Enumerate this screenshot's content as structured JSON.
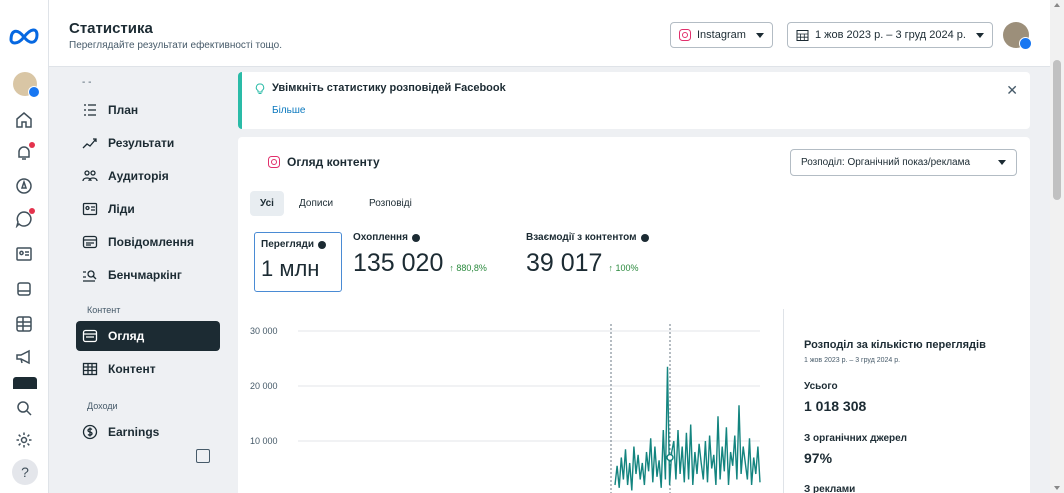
{
  "header": {
    "title": "Статистика",
    "subtitle": "Переглядайте результати ефективності тощо.",
    "platform_label": "Instagram",
    "date_range": "1 жов 2023 р. – 3 груд 2024 р."
  },
  "sidebar": {
    "top_partial": "- -",
    "items": [
      {
        "label": "План",
        "icon": "plan-icon"
      },
      {
        "label": "Результати",
        "icon": "results-icon"
      },
      {
        "label": "Аудиторія",
        "icon": "audience-icon"
      },
      {
        "label": "Ліди",
        "icon": "leads-icon"
      },
      {
        "label": "Повідомлення",
        "icon": "messages-icon"
      },
      {
        "label": "Бенчмаркінг",
        "icon": "benchmarking-icon"
      }
    ],
    "section_content": "Контент",
    "content_items": [
      {
        "label": "Огляд",
        "icon": "overview-icon",
        "active": true
      },
      {
        "label": "Контент",
        "icon": "content-table-icon"
      }
    ],
    "section_income": "Доходи",
    "income_items": [
      {
        "label": "Earnings",
        "icon": "earnings-icon"
      }
    ]
  },
  "banner": {
    "title": "Увімкніть статистику розповідей Facebook",
    "link": "Більше",
    "accent": "#2abba7"
  },
  "content_card": {
    "title": "Огляд контенту",
    "breakdown_label": "Розподіл: Органічний показ/реклама",
    "tabs": [
      "Усі",
      "Дописи",
      "Розповіді"
    ],
    "metrics": [
      {
        "label": "Перегляди",
        "value": "1 млн",
        "change": ""
      },
      {
        "label": "Охоплення",
        "value": "135 020",
        "change": "↑ 880,8%"
      },
      {
        "label": "Взаємодії з контентом",
        "value": "39 017",
        "change": "↑ 100%"
      }
    ]
  },
  "chart_data": {
    "type": "line",
    "title": "",
    "xlabel": "",
    "ylabel": "",
    "ylim": [
      0,
      30000
    ],
    "yticks": [
      "30 000",
      "20 000",
      "10 000"
    ],
    "series": [
      {
        "color": "#13847f",
        "values": [
          2000,
          5500,
          1500,
          7000,
          3000,
          8500,
          2000,
          6000,
          1000,
          9000,
          4000,
          7500,
          3000,
          6000,
          2000,
          8000,
          4500,
          10500,
          2500,
          9000,
          3500,
          6500,
          1500,
          12000,
          3000,
          23500,
          2000,
          8000,
          10000,
          3000,
          12000,
          4000,
          9000,
          2500,
          11500,
          3000,
          13000,
          2000,
          8000,
          4000,
          9500,
          6000,
          3000,
          10000,
          2500,
          11000,
          5000,
          7500,
          2000,
          14500,
          3000,
          9000,
          4500,
          12500,
          2000,
          8000,
          5500,
          11000,
          3000,
          16500,
          4000,
          9000,
          6000,
          3000,
          10500,
          2000,
          7000,
          4000,
          9000,
          2500
        ]
      }
    ],
    "vlines": 2
  },
  "side_stats": {
    "title": "Розподіл за кількістю переглядів",
    "date": "1 жов 2023 р. – 3 груд 2024 р.",
    "total_label": "Усього",
    "total_value": "1 018 308",
    "organic_label": "З органічних джерел",
    "organic_value": "97%",
    "ads_label": "З реклами"
  },
  "colors": {
    "accent_teal": "#13847f",
    "nav_active": "#1c2b33",
    "instagram": "#e1306c",
    "link": "#0a78be"
  }
}
